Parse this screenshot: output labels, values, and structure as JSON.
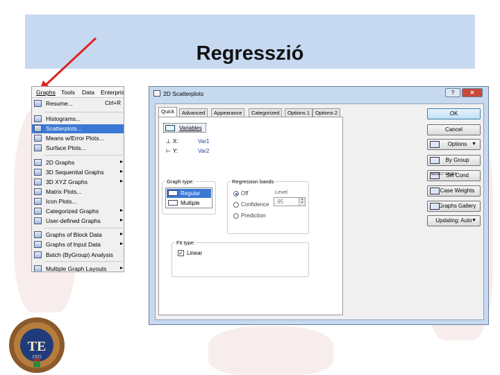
{
  "slide": {
    "title": "Regresszió"
  },
  "menubar": [
    "Graphs",
    "Tools",
    "Data",
    "Enterprise"
  ],
  "menu": {
    "items": [
      {
        "label": "Resume...",
        "shortcut": "Ctrl+R",
        "icon": "resume-icon"
      },
      {
        "label": "Histograms...",
        "icon": "histogram-icon"
      },
      {
        "label": "Scatterplots...",
        "icon": "scatterplot-icon",
        "highlighted": true
      },
      {
        "label": "Means w/Error Plots...",
        "icon": "means-plot-icon"
      },
      {
        "label": "Surface Plots...",
        "icon": "surface-plot-icon"
      },
      {
        "label": "2D Graphs",
        "icon": "2d-graph-icon",
        "submenu": true
      },
      {
        "label": "3D Sequential Graphs",
        "icon": "3d-sequential-icon",
        "submenu": true
      },
      {
        "label": "3D XYZ Graphs",
        "icon": "3d-xyz-icon",
        "submenu": true
      },
      {
        "label": "Matrix Plots...",
        "icon": "matrix-plot-icon"
      },
      {
        "label": "Icon Plots...",
        "icon": "icon-plot-icon"
      },
      {
        "label": "Categorized Graphs",
        "icon": "categorized-icon",
        "submenu": true
      },
      {
        "label": "User-defined Graphs",
        "icon": "user-defined-icon",
        "submenu": true
      },
      {
        "label": "Graphs of Block Data",
        "icon": "block-data-icon",
        "submenu": true
      },
      {
        "label": "Graphs of Input Data",
        "icon": "input-data-icon",
        "submenu": true
      },
      {
        "label": "Batch (ByGroup) Analysis",
        "icon": "batch-icon"
      },
      {
        "label": "Multiple Graph Layouts",
        "icon": "layouts-icon",
        "submenu": true
      }
    ],
    "submenu_glyph": "▸"
  },
  "dialog": {
    "title": "2D Scatterplots",
    "help_label": "?",
    "close_label": "✕",
    "tabs": [
      "Quick",
      "Advanced",
      "Appearance",
      "Categorized",
      "Options 1",
      "Options 2"
    ],
    "variables_label": "Variables",
    "x_label": "X:",
    "y_label": "Y:",
    "x_value": "Var1",
    "y_value": "Var2",
    "graph_type": {
      "label": "Graph type:",
      "items": [
        "Regular",
        "Multiple"
      ]
    },
    "regression_bands": {
      "label": "Regression bands",
      "options": [
        "Off",
        "Confidence",
        "Prediction"
      ],
      "level_label": "Level",
      "level_value": ".95"
    },
    "fit_type": {
      "label": "Fit type:",
      "option": "Linear",
      "checkmark": "✓"
    },
    "buttons": {
      "ok": "OK",
      "cancel": "Cancel",
      "options": "Options",
      "by_group": "By Group",
      "sel_cond": "Sel Cond",
      "case_weights": "Case Weights",
      "graphs_gallery": "Graphs Gallery",
      "updating": "Updating: Auto",
      "dropdown_glyph": "▼",
      "select_cases_icon_text": "SELECT CASES"
    }
  },
  "logo": {
    "initials": "TE",
    "year": "1925"
  },
  "colors": {
    "title_bg": "#c6d9f0",
    "highlight": "#3a78d4",
    "arrow": "#e02020"
  }
}
